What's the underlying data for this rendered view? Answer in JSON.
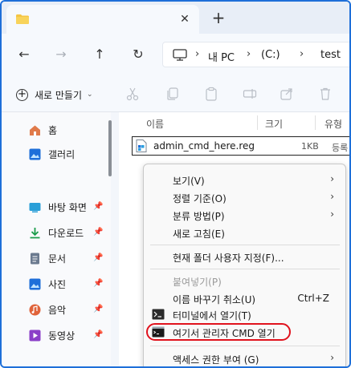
{
  "window": {
    "tab_close": "✕",
    "new_tab": "+"
  },
  "nav": {
    "back": "←",
    "forward": "→",
    "up": "↑",
    "refresh": "↻"
  },
  "address": {
    "sep": "›",
    "crumbs": [
      "내 PC",
      "(C:)",
      "test"
    ]
  },
  "toolbar": {
    "new_label": "새로 만들기",
    "icons": [
      "cut-icon",
      "copy-icon",
      "paste-icon",
      "rename-icon",
      "share-icon",
      "delete-icon"
    ]
  },
  "sidebar": {
    "pin_glyph": "📌",
    "items": [
      {
        "label": "홈",
        "icon": "home-icon",
        "color": "#d9534f"
      },
      {
        "label": "갤러리",
        "icon": "gallery-icon",
        "color": "#1e6fd9"
      },
      {
        "label": "바탕 화면",
        "icon": "desktop-icon",
        "color": "#2a9fd8",
        "pinned": true
      },
      {
        "label": "다운로드",
        "icon": "download-icon",
        "color": "#1a9c4a",
        "pinned": true
      },
      {
        "label": "문서",
        "icon": "documents-icon",
        "color": "#6b7a8f",
        "pinned": true
      },
      {
        "label": "사진",
        "icon": "pictures-icon",
        "color": "#1e6fd9",
        "pinned": true
      },
      {
        "label": "음악",
        "icon": "music-icon",
        "color": "#e0633a",
        "pinned": true
      },
      {
        "label": "동영상",
        "icon": "videos-icon",
        "color": "#8b3fc8",
        "pinned": true
      }
    ]
  },
  "list": {
    "columns": [
      "이름",
      "크기",
      "유형"
    ],
    "file": {
      "name": "admin_cmd_here.reg",
      "size": "1KB",
      "type": "등록"
    }
  },
  "context_menu": {
    "items": [
      {
        "label": "보기(V)",
        "submenu": true
      },
      {
        "label": "정렬 기준(O)",
        "submenu": true
      },
      {
        "label": "분류 방법(P)",
        "submenu": true
      },
      {
        "label": "새로 고침(E)"
      },
      {
        "label": "현재 폴더 사용자 지정(F)..."
      },
      {
        "label": "붙여넣기(P)",
        "disabled": true
      },
      {
        "label": "이름 바꾸기 취소(U)",
        "shortcut": "Ctrl+Z"
      },
      {
        "label": "터미널에서 열기(T)",
        "icon": "terminal-icon"
      },
      {
        "label": "여기서 관리자 CMD 열기",
        "icon": "cmd-icon",
        "highlighted": true
      },
      {
        "label": "액세스 권한 부여 (G)",
        "submenu": true
      }
    ],
    "arrow": "›",
    "highlight_color": "#e0121d"
  },
  "colors": {
    "accent": "#1e6fd9",
    "folder": "#f5c542"
  }
}
